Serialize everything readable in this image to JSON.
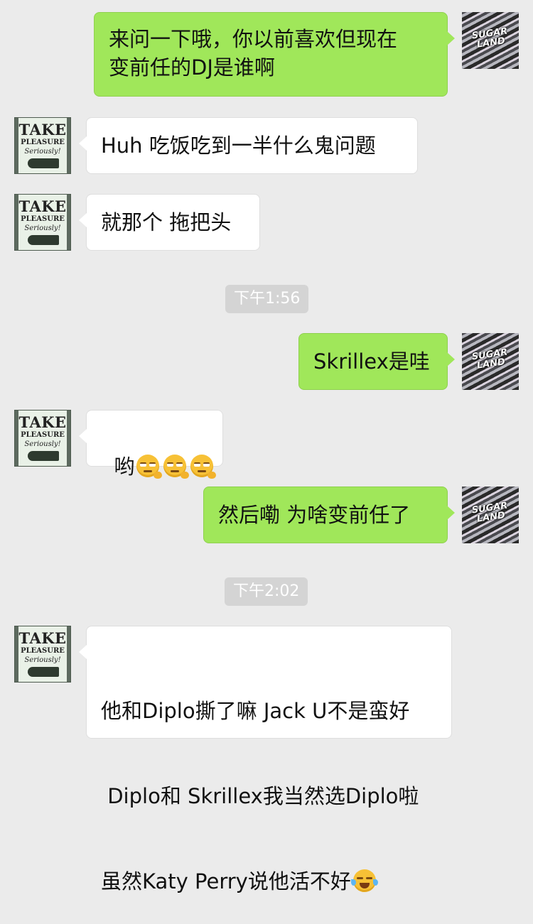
{
  "messages": [
    {
      "text": "来问一下哦，你以前喜欢但现在\n变前任的DJ是谁啊"
    },
    {
      "text": "Huh 吃饭吃到一半什么鬼问题"
    },
    {
      "text": "就那个 拖把头"
    },
    {
      "text": "Skrillex是哇"
    },
    {
      "text": "哟"
    },
    {
      "text": "然后嘞 为啥变前任了"
    },
    {
      "line1": "他和Diplo撕了嘛 Jack U不是蛮好",
      "line2": " Diplo和 Skrillex我当然选Diplo啦",
      "line3": "虽然Katy Perry说他活不好"
    }
  ],
  "timestamps": [
    "下午1:56",
    "下午2:02"
  ],
  "avatars": {
    "friend": {
      "line1": "TAKE",
      "line2": "PLEASURE",
      "line3": "Seriously!"
    },
    "self": {
      "logo_line1": "SUGAR",
      "logo_line2": "LAND"
    }
  },
  "colors": {
    "background": "#ebebeb",
    "outgoing_bubble": "#a0e75a",
    "incoming_bubble": "#ffffff",
    "timestamp_bg": "#d4d4d4"
  },
  "emojis": [
    "smirk-emoji",
    "smirk-emoji",
    "smirk-emoji",
    "laugh-cry-emoji"
  ]
}
